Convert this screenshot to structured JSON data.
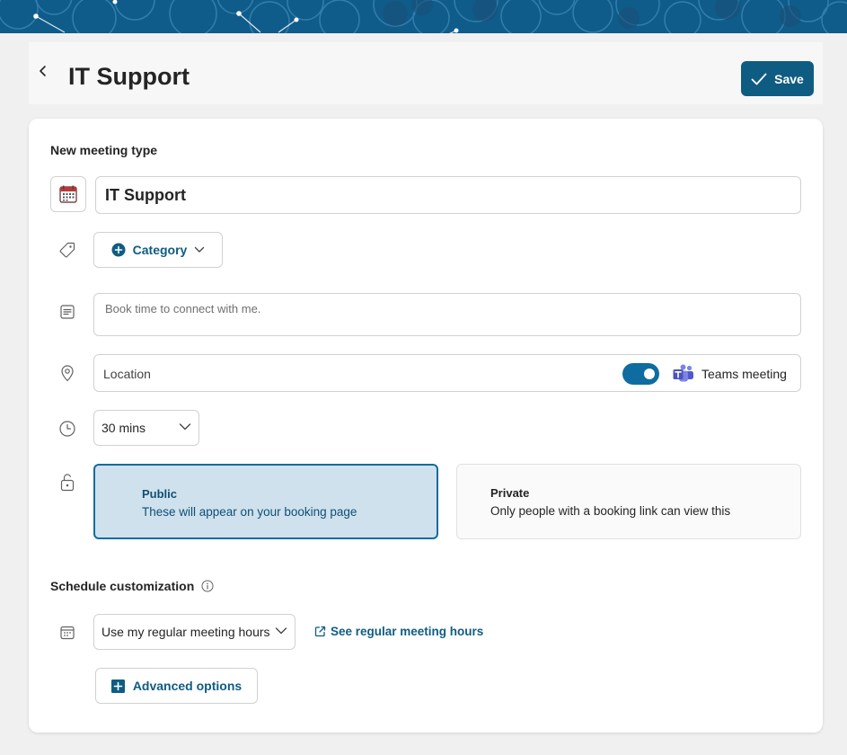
{
  "header": {
    "title": "IT Support",
    "save_label": "Save"
  },
  "form": {
    "section_title": "New meeting type",
    "name_value": "IT Support",
    "category_label": "Category",
    "description_placeholder": "Book time to connect with me.",
    "location_placeholder": "Location",
    "teams_meeting_on": true,
    "teams_label": "Teams meeting",
    "duration_value": "30 mins"
  },
  "visibility": {
    "selected": "public",
    "public": {
      "title": "Public",
      "description": "These will appear on your booking page"
    },
    "private": {
      "title": "Private",
      "description": "Only people with a booking link can view this"
    }
  },
  "schedule": {
    "section_title": "Schedule customization",
    "hours_value": "Use my regular meeting hours",
    "hours_link": "See regular meeting hours",
    "advanced_label": "Advanced options"
  },
  "colors": {
    "accent": "#0f5c82",
    "banner": "#0f5c8a",
    "public_bg": "#cfe1ed"
  }
}
